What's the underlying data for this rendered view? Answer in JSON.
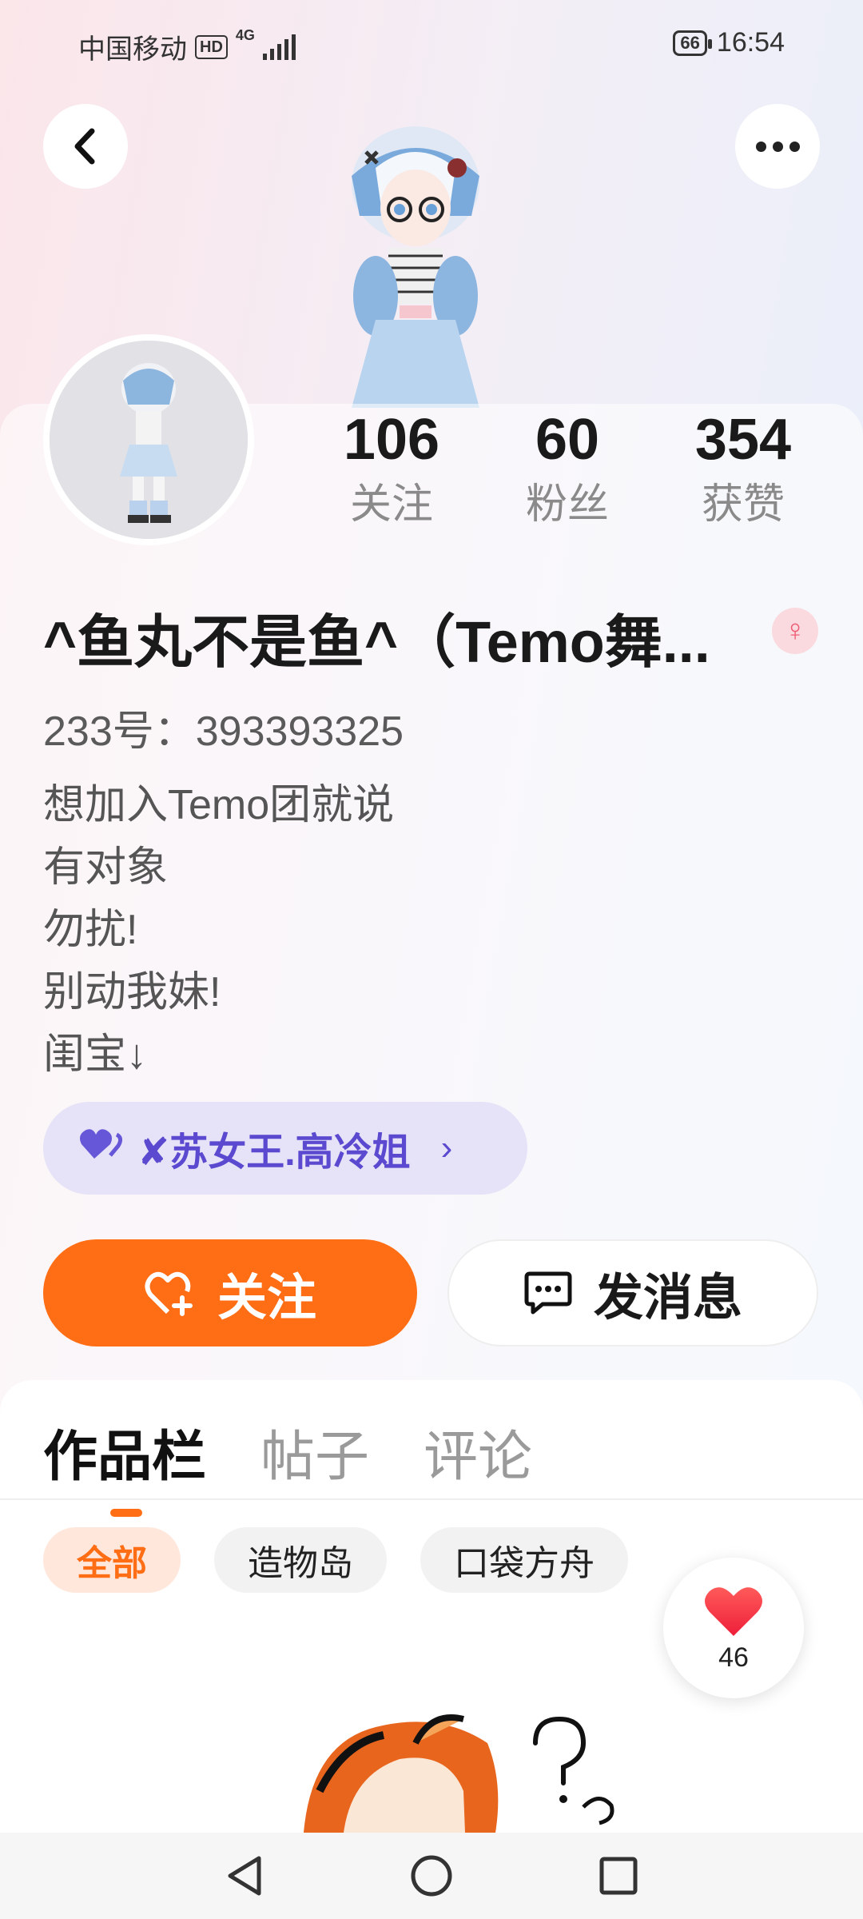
{
  "status_bar": {
    "carrier": "中国移动",
    "hd": "HD",
    "network": "4G",
    "battery": "66",
    "time": "16:54"
  },
  "profile": {
    "stats": [
      {
        "num": "106",
        "label": "关注"
      },
      {
        "num": "60",
        "label": "粉丝"
      },
      {
        "num": "354",
        "label": "获赞"
      }
    ],
    "name": "^鱼丸不是鱼^（Temo舞...",
    "gender": "♀",
    "uid": "233号：393393325",
    "bio": [
      "想加入Temo团就说",
      "有对象",
      "勿扰!",
      "别动我妹!",
      "闺宝↓"
    ],
    "cp_name": "✘苏女王.高冷姐",
    "follow_label": "关注",
    "message_label": "发消息"
  },
  "tabs": [
    "作品栏",
    "帖子",
    "评论"
  ],
  "chips": [
    "全部",
    "造物岛",
    "口袋方舟"
  ],
  "likes_count": "46",
  "colors": {
    "accent": "#ff6d14",
    "cp": "#5b4ad0"
  }
}
